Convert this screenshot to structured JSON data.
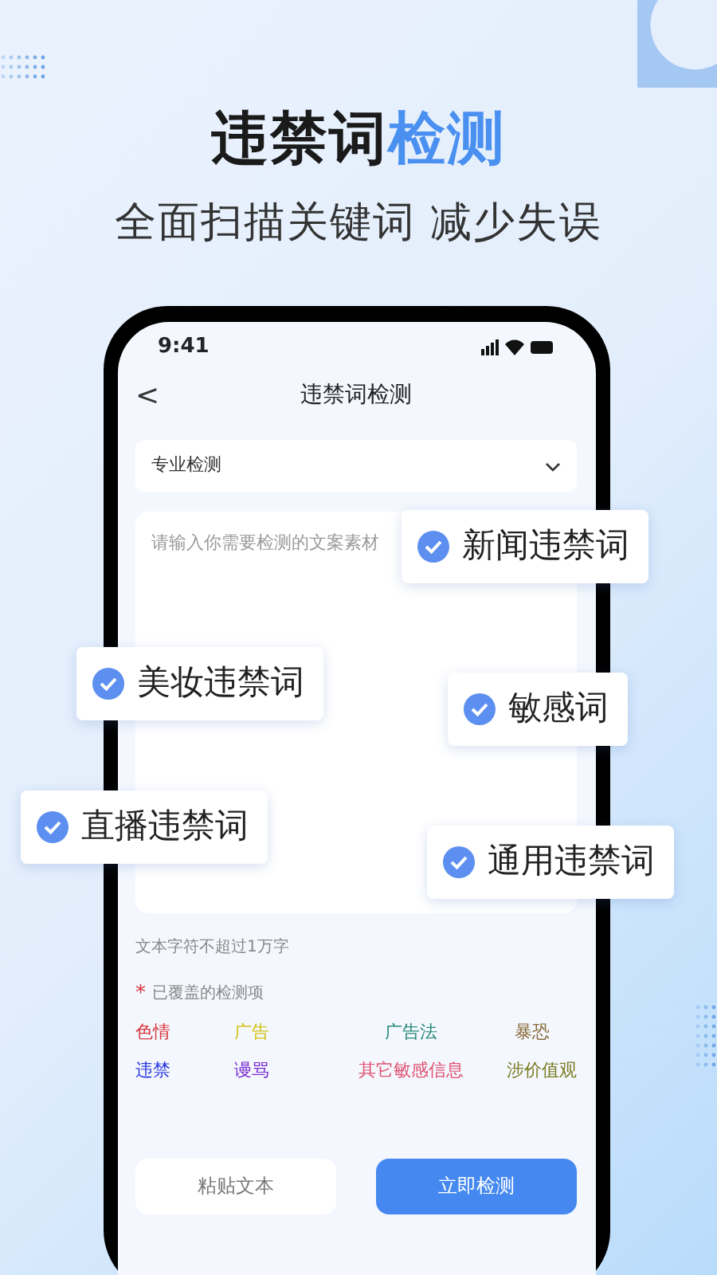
{
  "headline": [
    {
      "text": "违禁词",
      "kind": "dark"
    },
    {
      "text": "检测",
      "kind": "accent"
    }
  ],
  "subtitle": "全面扫描关键词 减少失误",
  "phone": {
    "status_bar": {
      "time": "9:41"
    },
    "nav": {
      "back": "<",
      "title": "违禁词检测"
    },
    "mode_select": {
      "value": "专业检测"
    },
    "text_input": {
      "placeholder": "请输入你需要检测的文案素材"
    },
    "limit_hint": "文本字符不超过1万字",
    "covered": {
      "required_mark": "*",
      "label": "已覆盖的检测项"
    },
    "tags": [
      {
        "text": "色情",
        "color": "#d9363e"
      },
      {
        "text": "广告",
        "color": "#d4c21a"
      },
      {
        "text": "广告法",
        "color": "#2a8a7a"
      },
      {
        "text": "暴恐",
        "color": "#8a6a3a"
      },
      {
        "text": "违禁",
        "color": "#2a3adf"
      },
      {
        "text": "谩骂",
        "color": "#7a2ad0"
      },
      {
        "text": "其它敏感信息",
        "color": "#e05070"
      },
      {
        "text": "涉价值观",
        "color": "#7a7a20"
      }
    ],
    "buttons": [
      {
        "label": "粘贴文本",
        "kind": "secondary"
      },
      {
        "label": "立即检测",
        "kind": "primary"
      }
    ]
  },
  "chips": [
    {
      "label": "新闻违禁词",
      "checked": true
    },
    {
      "label": "美妆违禁词",
      "checked": true
    },
    {
      "label": "敏感词",
      "checked": true
    },
    {
      "label": "直播违禁词",
      "checked": true
    },
    {
      "label": "通用违禁词",
      "checked": true
    }
  ]
}
